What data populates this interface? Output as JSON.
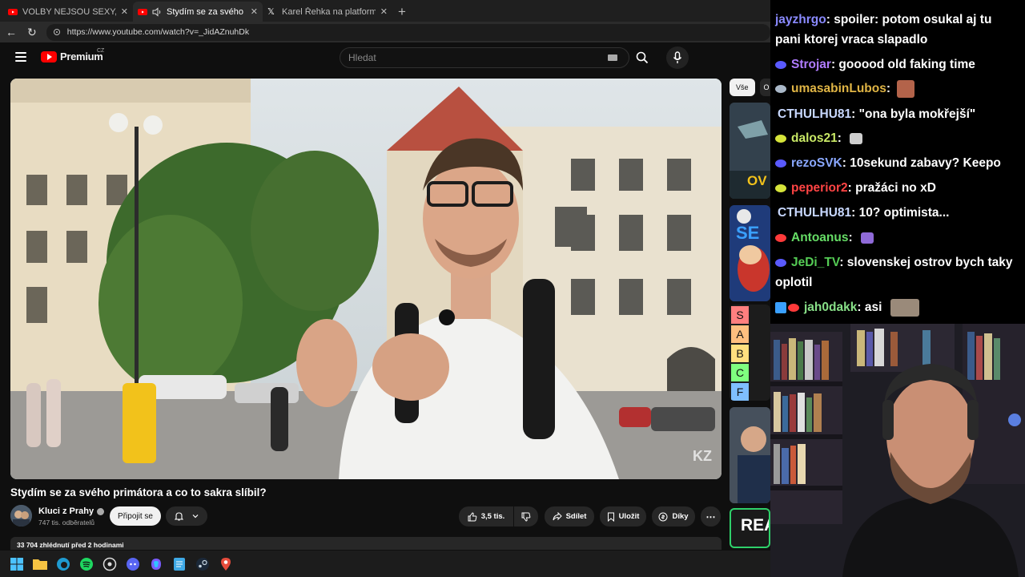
{
  "browser": {
    "tabs": [
      {
        "title": "VOLBY NEJSOU SEXY, Z NICH NE",
        "active": false
      },
      {
        "title": "Stydím se za svého primátora",
        "active": true
      },
      {
        "title": "Karel Řehka na platformě X: „Po v",
        "active": false
      }
    ],
    "url": "https://www.youtube.com/watch?v=_JidAZnuhDk",
    "new_tab": "+"
  },
  "youtube": {
    "brand": "Premium",
    "region": "CZ",
    "search_placeholder": "Hledat",
    "video": {
      "title": "Stydím se za svého primátora a co to sakra slíbil?",
      "watermark": "KZ"
    },
    "channel": {
      "name": "Kluci z Prahy",
      "subscribers": "747 tis. odběratelů",
      "join_label": "Připojit se"
    },
    "actions": {
      "likes": "3,5 tis.",
      "share": "Sdílet",
      "save": "Uložit",
      "thanks": "Díky",
      "more": "⋯"
    },
    "description_meta": "33 704 zhlédnutí  před 2 hodinami",
    "chips": [
      "Vše",
      "O"
    ],
    "tier_labels": [
      "S",
      "A",
      "B",
      "C",
      "F"
    ],
    "thumb_texts": [
      "OV",
      "SE",
      "REA"
    ]
  },
  "chat": {
    "messages": [
      {
        "user": "jayzhrgo",
        "color": "#8a8aff",
        "text": ": spoiler: potom osukal aj tu pani ktorej vraca slapadlo",
        "badge": "#6a5cff"
      },
      {
        "user": "Strojar",
        "color": "#b07cff",
        "text": ": gooood old faking time",
        "badge": "#5a5aff"
      },
      {
        "user": "umasabinLubos",
        "color": "#e0b545",
        "text": ":",
        "badge": "#aab8c8"
      },
      {
        "user": "CTHULHU81",
        "color": "#c8d8ff",
        "text": ": \"ona byla mokřejší\"",
        "badge": ""
      },
      {
        "user": "dalos21",
        "color": "#c8e866",
        "text": ":",
        "badge": "#d6e43a"
      },
      {
        "user": "rezoSVK",
        "color": "#8aa8ff",
        "text": ": 10sekund zabavy? Keepo",
        "badge": "#5a5aff"
      },
      {
        "user": "peperior2",
        "color": "#ff4444",
        "text": ": pražáci no xD",
        "badge": "#d6e43a"
      },
      {
        "user": "CTHULHU81",
        "color": "#c8d8ff",
        "text": ": 10? optimista...",
        "badge": ""
      },
      {
        "user": "Antoanus",
        "color": "#66dd66",
        "text": ":",
        "badge": "#ff3a3a"
      },
      {
        "user": "JeDi_TV",
        "color": "#55cc55",
        "text": ": slovenskej ostrov bych taky oplotil",
        "badge": "#5a5aff"
      },
      {
        "user": "jah0dakk",
        "color": "#88e088",
        "text": ": asi",
        "badge": "#ff3a3a"
      }
    ]
  },
  "colors": {
    "accent_red": "#ff0000",
    "bg": "#0f0f0f",
    "button_bg": "#272727"
  }
}
